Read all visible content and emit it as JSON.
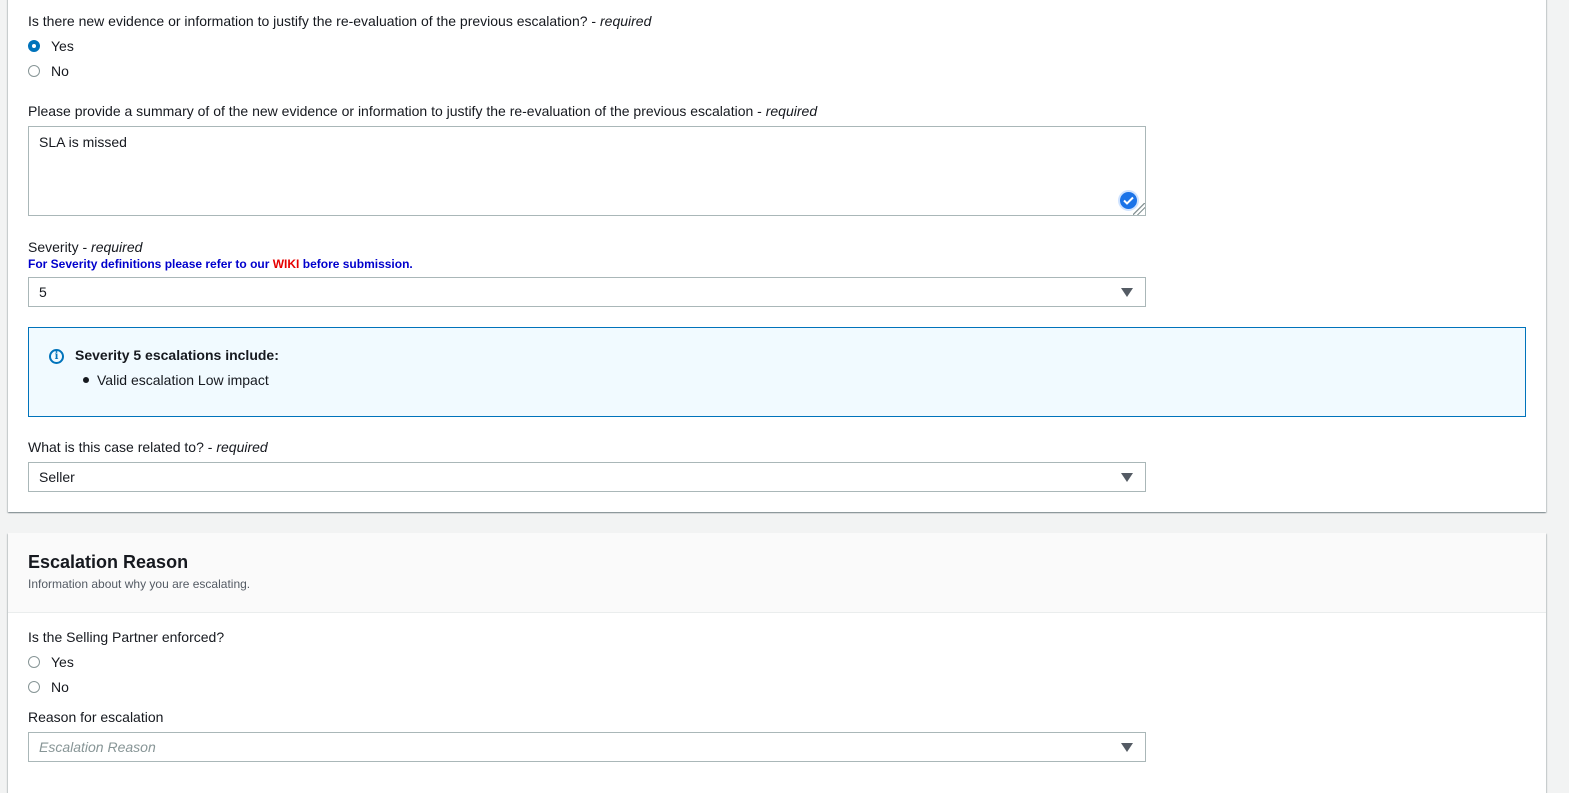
{
  "evidence_question": {
    "label": "Is there new evidence or information to justify the re-evaluation of the previous escalation?",
    "required_prefix": " - ",
    "required": "required",
    "options": [
      "Yes",
      "No"
    ],
    "selected": "Yes"
  },
  "summary": {
    "label": "Please provide a summary of of the new evidence or information to justify the re-evaluation of the previous escalation",
    "required_prefix": " - ",
    "required": "required",
    "value": "SLA is missed"
  },
  "severity": {
    "label": "Severity",
    "required_prefix": " - ",
    "required": "required",
    "hint_before": "For Severity definitions please refer to our ",
    "hint_link": "WIKI",
    "hint_after": " before submission.",
    "value": "5"
  },
  "severity_info": {
    "title": "Severity 5 escalations include:",
    "items": [
      "Valid escalation Low impact"
    ]
  },
  "case_related": {
    "label": "What is this case related to?",
    "required_prefix": " - ",
    "required": "required",
    "value": "Seller"
  },
  "escalation_section": {
    "title": "Escalation Reason",
    "subtitle": "Information about why you are escalating."
  },
  "enforced_question": {
    "label": "Is the Selling Partner enforced?",
    "options": [
      "Yes",
      "No"
    ],
    "selected": null
  },
  "escalation_reason": {
    "label": "Reason for escalation",
    "placeholder": "Escalation Reason"
  },
  "colors": {
    "accent": "#0073bb",
    "hint_text": "#0000cc",
    "wiki_link": "#e60000"
  }
}
